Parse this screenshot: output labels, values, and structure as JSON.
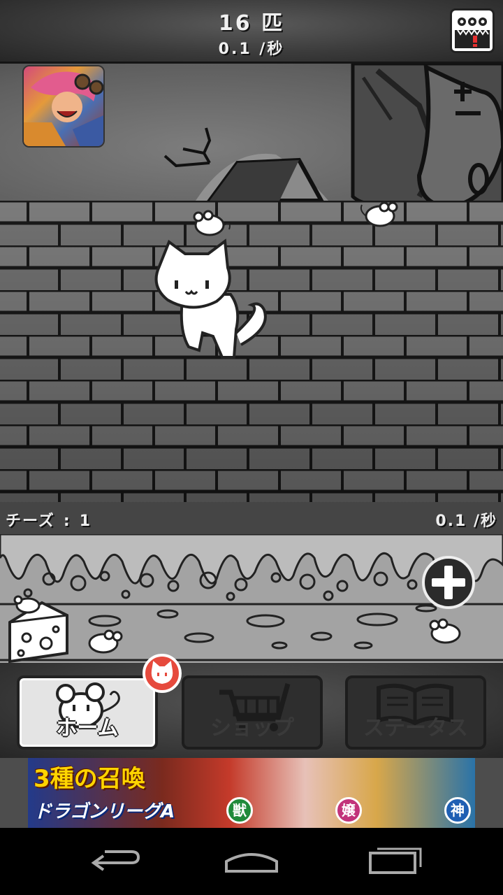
{
  "header": {
    "count_text": "16 匹",
    "rate_text": "0.1 /秒",
    "menu_icon": "creatures-alert-icon"
  },
  "cheese_panel": {
    "label": "チーズ",
    "colon": ":",
    "count": "1",
    "rate_text": "0.1 /秒",
    "add_icon": "plus-circle-icon",
    "cheese_icon": "cheese-wedge-icon"
  },
  "tabs": [
    {
      "label": "ホーム",
      "icon": "mouse-icon",
      "active": true
    },
    {
      "label": "ショップ",
      "icon": "shopping-cart-icon",
      "active": false
    },
    {
      "label": "ステータス",
      "icon": "open-book-icon",
      "active": false
    }
  ],
  "tab_badge_icon": "cat-face-icon",
  "ad": {
    "title": "3種の召喚",
    "logo": "ドラゴンリーグA",
    "badges": [
      "獣",
      "嬢",
      "神"
    ],
    "badge_colors": [
      "#1f8a3a",
      "#c2337a",
      "#1f5fb3"
    ]
  },
  "navbar": {
    "back_icon": "back-arrow-icon",
    "home_icon": "home-icon",
    "recents_icon": "recent-apps-icon"
  }
}
